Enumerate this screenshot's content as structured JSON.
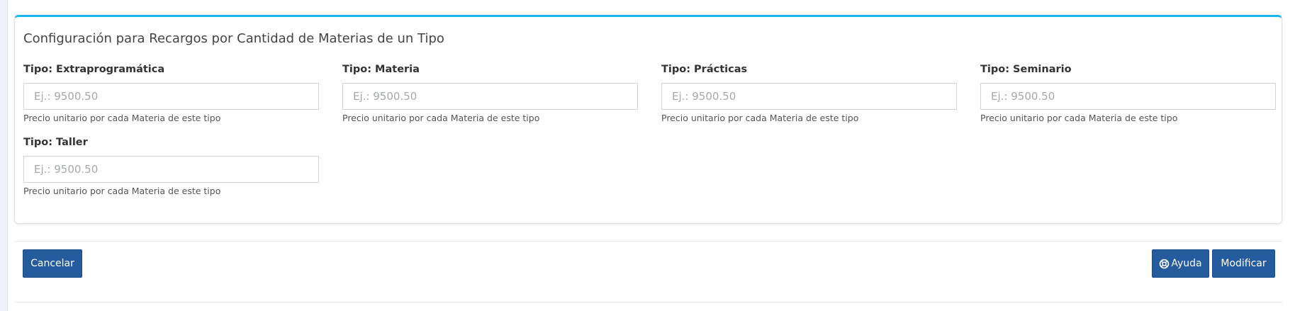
{
  "form": {
    "title": "Configuración para Recargos por Cantidad de Materias de un Tipo",
    "fields": [
      {
        "label": "Tipo: Extraprogramática",
        "placeholder": "Ej.: 9500.50",
        "help": "Precio unitario por cada Materia de este tipo"
      },
      {
        "label": "Tipo: Materia",
        "placeholder": "Ej.: 9500.50",
        "help": "Precio unitario por cada Materia de este tipo"
      },
      {
        "label": "Tipo: Prácticas",
        "placeholder": "Ej.: 9500.50",
        "help": "Precio unitario por cada Materia de este tipo"
      },
      {
        "label": "Tipo: Seminario",
        "placeholder": "Ej.: 9500.50",
        "help": "Precio unitario por cada Materia de este tipo"
      },
      {
        "label": "Tipo: Taller",
        "placeholder": "Ej.: 9500.50",
        "help": "Precio unitario por cada Materia de este tipo"
      }
    ]
  },
  "actions": {
    "cancel_label": "Cancelar",
    "help_label": "Ayuda",
    "help_icon": "lifebuoy-icon",
    "modify_label": "Modificar"
  },
  "colors": {
    "accent_top_border": "#1ab7ea",
    "button_primary": "#235b9c"
  }
}
